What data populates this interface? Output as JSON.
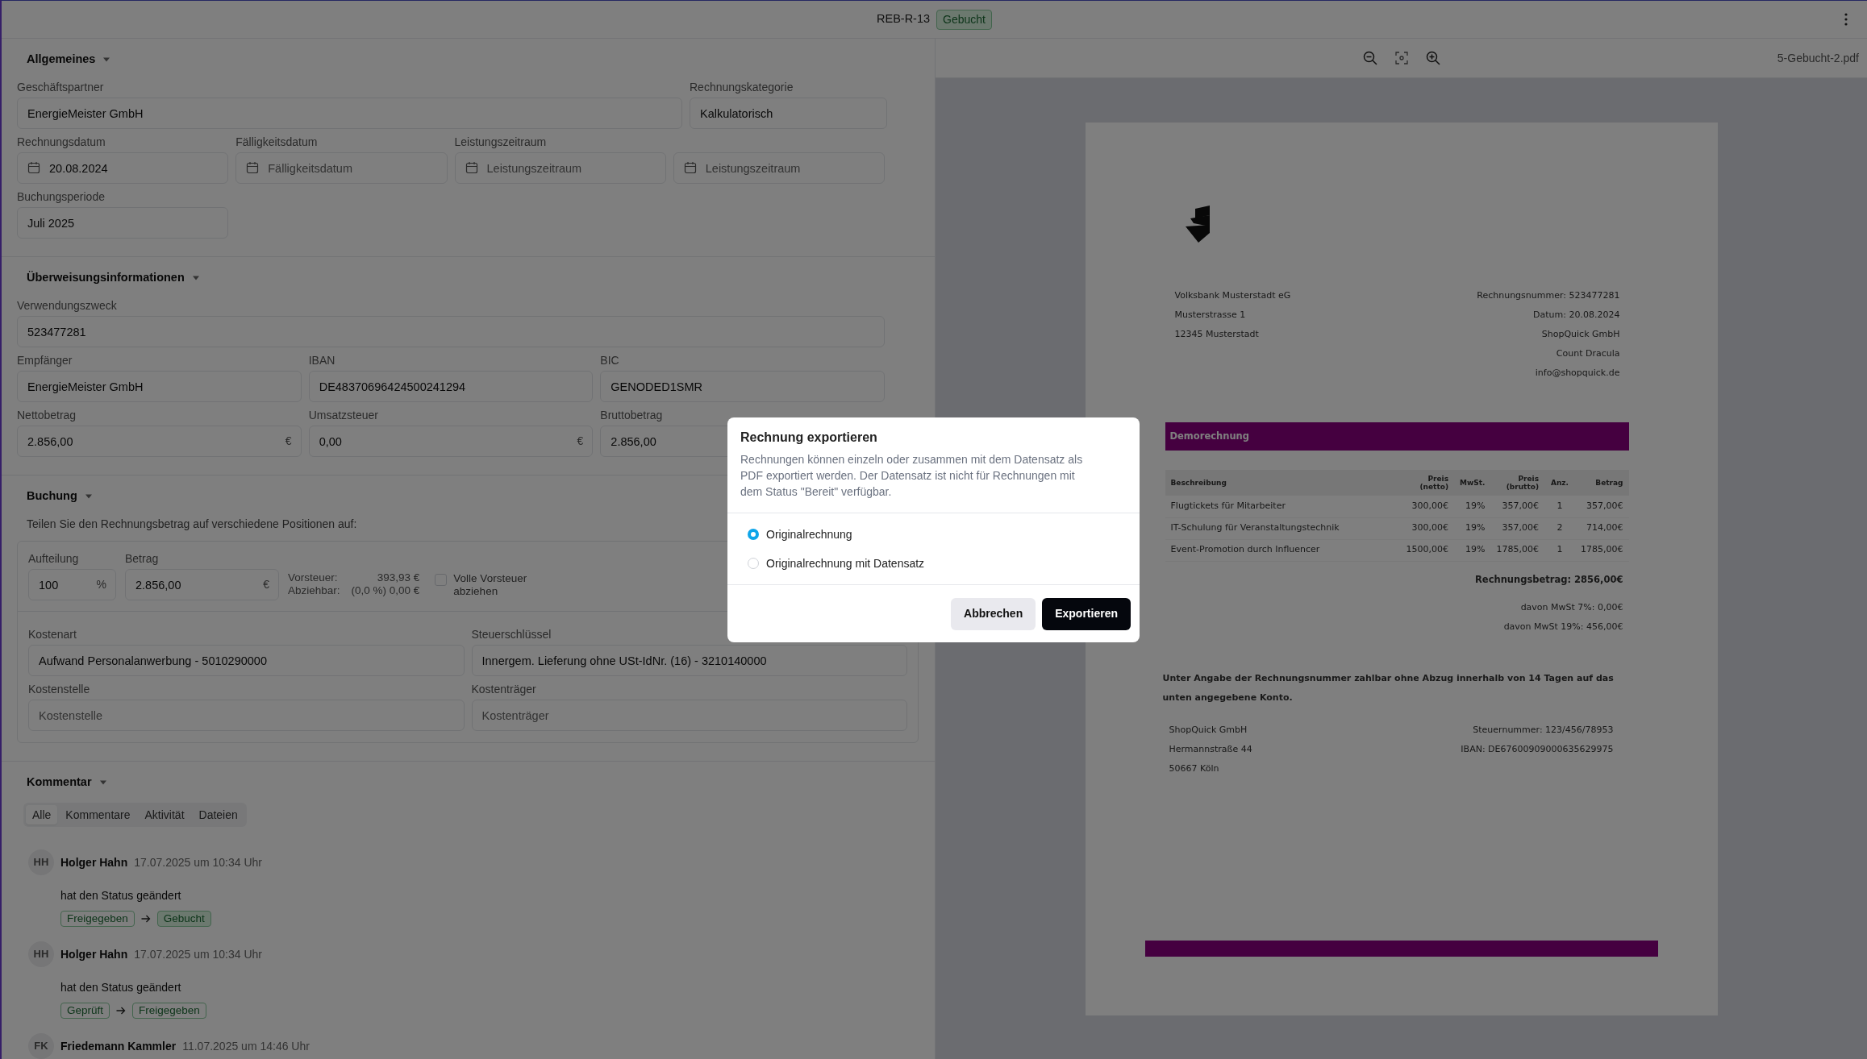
{
  "header": {
    "title": "REB-R-13",
    "status": "Gebucht"
  },
  "general": {
    "title": "Allgemeines",
    "expanded": true,
    "partner": {
      "label": "Geschäftspartner",
      "value": "EnergieMeister GmbH"
    },
    "category": {
      "label": "Rechnungskategorie",
      "value": "Kalkulatorisch"
    },
    "dates": [
      {
        "label": "Rechnungsdatum",
        "value": "20.08.2024",
        "kind": "date"
      },
      {
        "label": "Fälligkeitsdatum",
        "placeholder": "Fälligkeitsdatum",
        "kind": "date"
      },
      {
        "label": "Leistungszeitraum",
        "placeholder": "Leistungszeitraum",
        "kind": "date"
      },
      {
        "placeholder": "Leistungszeitraum",
        "kind": "date"
      }
    ],
    "period": {
      "label": "Buchungsperiode",
      "value": "Juli 2025"
    }
  },
  "transfer": {
    "title": "Überweisungsinformationen",
    "expanded": true,
    "rows": [
      [
        {
          "label": "Verwendungszweck",
          "value": "523477281"
        }
      ],
      [
        {
          "label": "Empfänger",
          "value": "EnergieMeister GmbH"
        },
        {
          "label": "IBAN",
          "value": "DE48370696424500241294"
        },
        {
          "label": "BIC",
          "value": "GENODED1SMR"
        }
      ],
      [
        {
          "label": "Nettobetrag",
          "value": "2.856,00",
          "suffix": "€"
        },
        {
          "label": "Umsatzsteuer",
          "value": "0,00",
          "suffix": "€"
        },
        {
          "label": "Bruttobetrag",
          "value": "2.856,00"
        }
      ]
    ]
  },
  "booking": {
    "title": "Buchung",
    "expanded": true,
    "hint": "Teilen Sie den Rechnungsbetrag auf verschiedene Positionen auf:",
    "split": {
      "label": "Aufteilung",
      "value": "100",
      "suffix": "%"
    },
    "amount": {
      "label": "Betrag",
      "value": "2.856,00",
      "suffix": "€"
    },
    "tax": [
      {
        "label": "Vorsteuer:",
        "value": "393,93 €"
      },
      {
        "label": "Abziehbar:",
        "value": "(0,0 %) 0,00 €"
      }
    ],
    "full_tax": {
      "label": "Volle Vorsteuer abziehen",
      "checked": false
    },
    "rows": [
      [
        {
          "label": "Kostenart",
          "value": "Aufwand Personalanwerbung - 5010290000"
        },
        {
          "label": "Steuerschlüssel",
          "value": "Innergem. Lieferung ohne USt-IdNr. (16) - 3210140000"
        }
      ],
      [
        {
          "label": "Kostenstelle",
          "placeholder": "Kostenstelle"
        },
        {
          "label": "Kostenträger",
          "placeholder": "Kostenträger"
        }
      ]
    ]
  },
  "comments": {
    "title": "Kommentar",
    "expanded": true,
    "tabs": [
      {
        "label": "Alle",
        "selected": true
      },
      {
        "label": "Kommentare",
        "selected": false
      },
      {
        "label": "Aktivität",
        "selected": false
      },
      {
        "label": "Dateien",
        "selected": false
      }
    ],
    "entries": [
      {
        "initials": "HH",
        "author": "Holger Hahn",
        "time": "17.07.2025 um 10:34 Uhr",
        "text": "hat den Status geändert",
        "from": {
          "label": "Freigegeben",
          "filled": false
        },
        "to": {
          "label": "Gebucht",
          "filled": true
        }
      },
      {
        "initials": "HH",
        "author": "Holger Hahn",
        "time": "17.07.2025 um 10:34 Uhr",
        "text": "hat den Status geändert",
        "from": {
          "label": "Geprüft",
          "filled": false
        },
        "to": {
          "label": "Freigegeben",
          "filled": false
        }
      },
      {
        "initials": "FK",
        "author": "Friedemann Kammler",
        "time": "11.07.2025 um 14:46 Uhr"
      }
    ]
  },
  "viewer": {
    "filename": "5-Gebucht-2.pdf",
    "document": {
      "sender": [
        "Volksbank Musterstadt eG",
        "Musterstrasse 1",
        "12345 Musterstadt"
      ],
      "meta": [
        "Rechnungsnummer: 523477281",
        "Datum: 20.08.2024",
        "ShopQuick GmbH",
        "Count Dracula",
        "info@shopquick.de"
      ],
      "banner": "Demorechnung",
      "columns": [
        "Beschreibung",
        "Preis (netto)",
        "MwSt.",
        "Preis (brutto)",
        "Anz.",
        "Betrag"
      ],
      "rows": [
        [
          "Flugtickets für Mitarbeiter",
          "300,00€",
          "19%",
          "357,00€",
          "1",
          "357,00€"
        ],
        [
          "IT-Schulung für Veranstaltungstechnik",
          "300,00€",
          "19%",
          "357,00€",
          "2",
          "714,00€"
        ],
        [
          "Event-Promotion durch Influencer",
          "1500,00€",
          "19%",
          "1785,00€",
          "1",
          "1785,00€"
        ]
      ],
      "total": "Rechnungsbetrag: 2856,00€",
      "tax_lines": [
        "davon MwSt 7%: 0,00€",
        "davon MwSt 19%: 456,00€"
      ],
      "payment_note": "Unter Angabe der Rechnungsnummer zahlbar ohne Abzug innerhalb von 14 Tagen auf das unten angegebene Konto.",
      "footer_left": [
        "ShopQuick GmbH",
        "Hermannstraße 44",
        "50667 Köln"
      ],
      "footer_right": [
        "Steuernummer: 123/456/78953",
        "IBAN: DE67600909000635629975"
      ]
    }
  },
  "modal": {
    "title": "Rechnung exportieren",
    "text": "Rechnungen können einzeln oder zusammen mit dem Datensatz als PDF exportiert werden. Der Datensatz ist nicht für Rechnungen mit dem Status \"Bereit\" verfügbar.",
    "options": [
      {
        "label": "Originalrechnung",
        "selected": true
      },
      {
        "label": "Originalrechnung mit Datensatz",
        "selected": false
      }
    ],
    "buttons": [
      {
        "label": "Abbrechen",
        "kind": "secondary"
      },
      {
        "label": "Exportieren",
        "kind": "primary"
      }
    ]
  }
}
